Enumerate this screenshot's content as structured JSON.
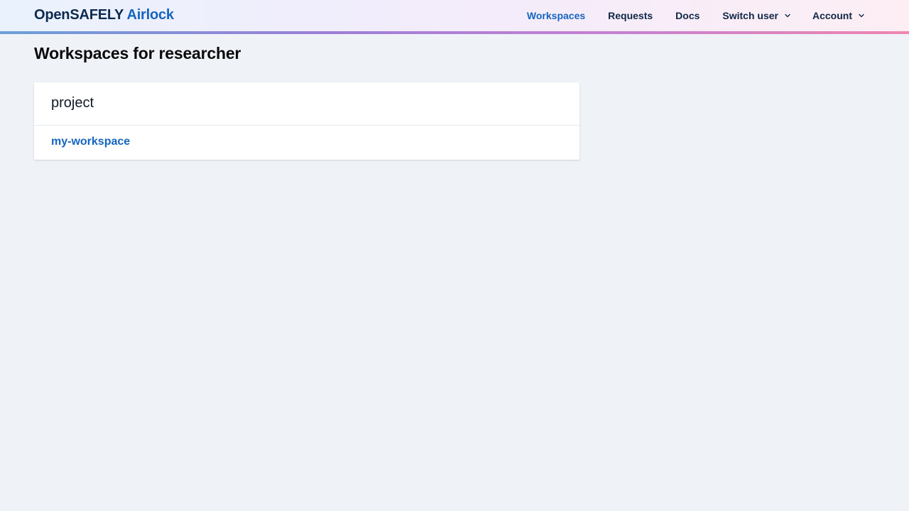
{
  "header": {
    "brand_primary": "OpenSAFELY",
    "brand_secondary": "Airlock",
    "nav": {
      "workspaces": "Workspaces",
      "requests": "Requests",
      "docs": "Docs",
      "switch_user": "Switch user",
      "account": "Account"
    },
    "active_item": "Workspaces"
  },
  "main": {
    "title": "Workspaces for researcher",
    "projects": [
      {
        "name": "project",
        "workspaces": [
          "my-workspace"
        ]
      }
    ]
  },
  "colors": {
    "accent": "#1565c0",
    "brand_dark": "#0c2a4d",
    "page_background": "#eff3f8"
  },
  "icons": {
    "switch_user_menu": "chevron-down-icon",
    "account_menu": "chevron-down-icon"
  }
}
